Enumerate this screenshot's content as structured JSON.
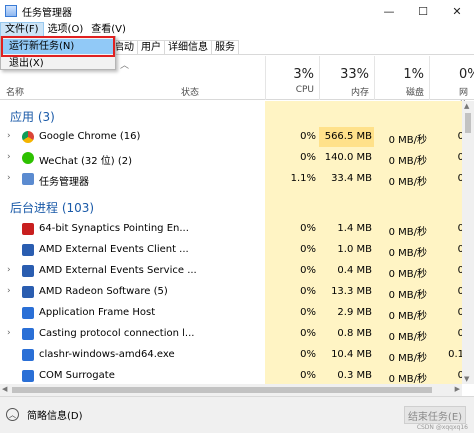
{
  "window": {
    "title": "任务管理器",
    "minimize": "—",
    "maximize": "☐",
    "close": "✕"
  },
  "menubar": [
    "文件(F)",
    "选项(O)",
    "查看(V)"
  ],
  "tabs": [
    "启动",
    "用户",
    "详细信息",
    "服务"
  ],
  "file_menu": [
    "运行新任务(N)",
    "退出(X)"
  ],
  "columns": {
    "name": "名称",
    "status": "状态",
    "cpu_pct": "3%",
    "cpu": "CPU",
    "mem_pct": "33%",
    "mem": "内存",
    "disk_pct": "1%",
    "disk": "磁盘",
    "net_pct": "0%",
    "net": "网络"
  },
  "groups": {
    "apps": "应用 (3)",
    "background": "后台进程 (103)"
  },
  "rows": [
    {
      "name": "Google Chrome (16)",
      "cpu": "0%",
      "mem": "566.5 MB",
      "disk": "0 MB/秒",
      "net": "0",
      "icon": "chrome-icon",
      "color": "#4285f4"
    },
    {
      "name": "WeChat (32 位) (2)",
      "cpu": "0%",
      "mem": "140.0 MB",
      "disk": "0 MB/秒",
      "net": "0",
      "icon": "wechat-icon",
      "color": "#2dc100"
    },
    {
      "name": "任务管理器",
      "cpu": "1.1%",
      "mem": "33.4 MB",
      "disk": "0 MB/秒",
      "net": "0",
      "icon": "task-manager-icon",
      "color": "#5b8bd0"
    },
    {
      "name": "64-bit Synaptics Pointing En...",
      "cpu": "0%",
      "mem": "1.4 MB",
      "disk": "0 MB/秒",
      "net": "0",
      "icon": "synaptics-icon",
      "color": "#c81f1f"
    },
    {
      "name": "AMD External Events Client ...",
      "cpu": "0%",
      "mem": "1.0 MB",
      "disk": "0 MB/秒",
      "net": "0",
      "icon": "amd-icon",
      "color": "#2a5db0"
    },
    {
      "name": "AMD External Events Service ...",
      "cpu": "0%",
      "mem": "0.4 MB",
      "disk": "0 MB/秒",
      "net": "0",
      "icon": "amd-service-icon",
      "color": "#2a5db0"
    },
    {
      "name": "AMD Radeon Software (5)",
      "cpu": "0%",
      "mem": "13.3 MB",
      "disk": "0 MB/秒",
      "net": "0",
      "icon": "radeon-icon",
      "color": "#2a5db0"
    },
    {
      "name": "Application Frame Host",
      "cpu": "0%",
      "mem": "2.9 MB",
      "disk": "0 MB/秒",
      "net": "0",
      "icon": "app-frame-icon",
      "color": "#2a6fd6"
    },
    {
      "name": "Casting protocol connection l...",
      "cpu": "0%",
      "mem": "0.8 MB",
      "disk": "0 MB/秒",
      "net": "0",
      "icon": "casting-icon",
      "color": "#2a6fd6"
    },
    {
      "name": "clashr-windows-amd64.exe",
      "cpu": "0%",
      "mem": "10.4 MB",
      "disk": "0 MB/秒",
      "net": "0.1",
      "icon": "exe-icon",
      "color": "#2a6fd6"
    },
    {
      "name": "COM Surrogate",
      "cpu": "0%",
      "mem": "0.3 MB",
      "disk": "0 MB/秒",
      "net": "0",
      "icon": "com-icon",
      "color": "#2a6fd6"
    }
  ],
  "footer": {
    "less_details": "简略信息(D)",
    "end_task": "结束任务(E)",
    "watermark": "CSDN @xqqxq16"
  }
}
